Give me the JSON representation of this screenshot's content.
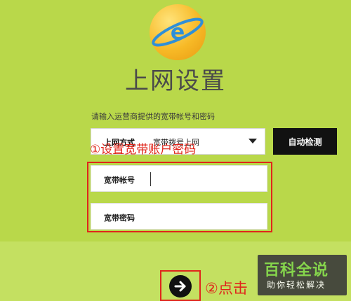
{
  "page": {
    "title": "上网设置",
    "hint": "请输入运营商提供的宽带帐号和密码"
  },
  "connection": {
    "label": "上网方式",
    "value": "宽带拨号上网",
    "detect_button": "自动检测"
  },
  "fields": {
    "account_label": "宽带帐号",
    "password_label": "宽带密码"
  },
  "annotations": {
    "step1": "①设置宽带账户密码",
    "step2": "②点击"
  },
  "watermark": {
    "main": "百科全说",
    "sub": "助你轻松解决"
  },
  "colors": {
    "background": "#b9d84a",
    "annotation_red": "#e0251b",
    "button_dark": "#111111"
  },
  "icons": {
    "logo": "planet-e-logo-icon",
    "select": "chevron-down-icon",
    "next": "arrow-right-icon"
  }
}
